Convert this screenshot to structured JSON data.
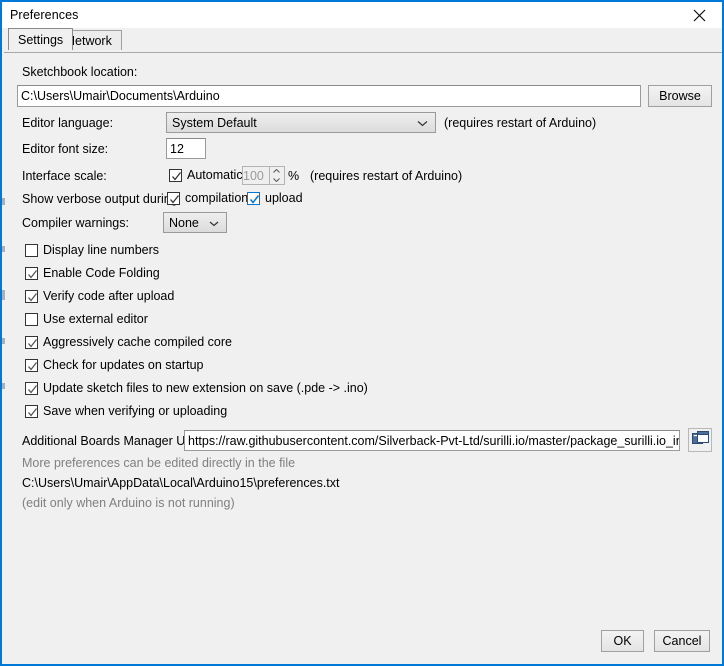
{
  "window": {
    "title": "Preferences",
    "close_icon": "close-icon",
    "accent_color": "#0078d7",
    "background_color": "#f0f0f0"
  },
  "tabs": [
    {
      "label": "Settings",
      "active": true
    },
    {
      "label": "Network",
      "active": false
    }
  ],
  "settings": {
    "sketchbook": {
      "label": "Sketchbook location:",
      "value": "C:\\Users\\Umair\\Documents\\Arduino",
      "browse_label": "Browse"
    },
    "editor_language": {
      "label": "Editor language:",
      "value": "System Default",
      "note": "(requires restart of Arduino)"
    },
    "editor_font_size": {
      "label": "Editor font size:",
      "value": "12"
    },
    "interface_scale": {
      "label": "Interface scale:",
      "automatic_label": "Automatic",
      "automatic_checked": true,
      "scale_value": "100",
      "percent_symbol": "%",
      "note": "(requires restart of Arduino)"
    },
    "verbose_output": {
      "label": "Show verbose output during:",
      "compilation_label": "compilation",
      "compilation_checked": true,
      "upload_label": "upload",
      "upload_checked": true,
      "upload_focused": true
    },
    "compiler_warnings": {
      "label": "Compiler warnings:",
      "value": "None"
    },
    "checkboxes": [
      {
        "label": "Display line numbers",
        "checked": false
      },
      {
        "label": "Enable Code Folding",
        "checked": true
      },
      {
        "label": "Verify code after upload",
        "checked": true
      },
      {
        "label": "Use external editor",
        "checked": false
      },
      {
        "label": "Aggressively cache compiled core",
        "checked": true
      },
      {
        "label": "Check for updates on startup",
        "checked": true
      },
      {
        "label": "Update sketch files to new extension on save (.pde -> .ino)",
        "checked": true
      },
      {
        "label": "Save when verifying or uploading",
        "checked": true
      }
    ],
    "boards_manager": {
      "label": "Additional Boards Manager URLs:",
      "value": "https://raw.githubusercontent.com/Silverback-Pvt-Ltd/surilli.io/master/package_surilli.io_index.json",
      "icon": "window-list-icon"
    },
    "footer": {
      "line1": "More preferences can be edited directly in the file",
      "line2": "C:\\Users\\Umair\\AppData\\Local\\Arduino15\\preferences.txt",
      "line3": "(edit only when Arduino is not running)"
    }
  },
  "buttons": {
    "ok": "OK",
    "cancel": "Cancel"
  }
}
